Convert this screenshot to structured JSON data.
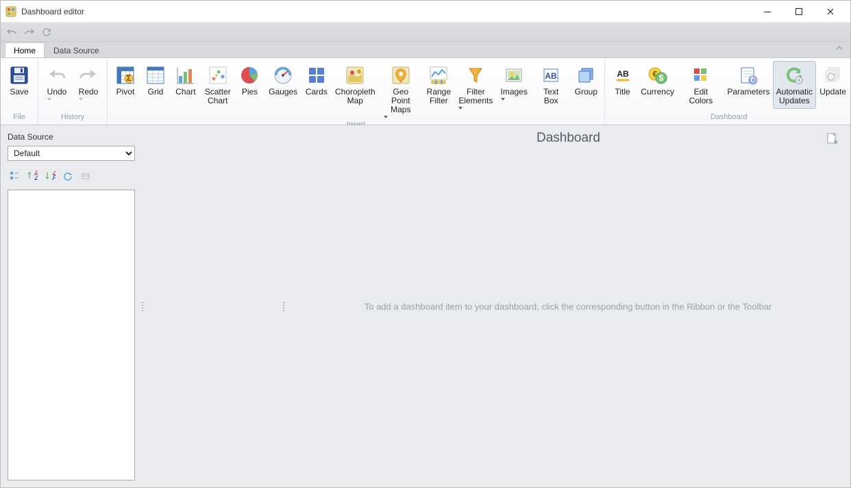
{
  "window": {
    "title": "Dashboard editor"
  },
  "tabs": {
    "home": "Home",
    "data_source": "Data Source"
  },
  "ribbon": {
    "groups": {
      "file": "File",
      "history": "History",
      "insert": "Insert",
      "dashboard": "Dashboard"
    },
    "file": {
      "save": "Save"
    },
    "history": {
      "undo": "Undo",
      "redo": "Redo"
    },
    "insert": {
      "pivot": "Pivot",
      "grid": "Grid",
      "chart": "Chart",
      "scatter": "Scatter\nChart",
      "pies": "Pies",
      "gauges": "Gauges",
      "cards": "Cards",
      "choro": "Choropleth\nMap",
      "geo": "Geo Point\nMaps",
      "range": "Range\nFilter",
      "filter": "Filter\nElements",
      "images": "Images",
      "textbox": "Text Box",
      "group": "Group"
    },
    "dashboard": {
      "title": "Title",
      "currency": "Currency",
      "colors": "Edit Colors",
      "params": "Parameters",
      "auto": "Automatic\nUpdates",
      "update": "Update"
    }
  },
  "side": {
    "label": "Data Source",
    "selected": "Default"
  },
  "canvas": {
    "title": "Dashboard",
    "hint": "To add a dashboard item to your dashboard, click the corresponding button in the Ribbon or the Toolbar"
  }
}
